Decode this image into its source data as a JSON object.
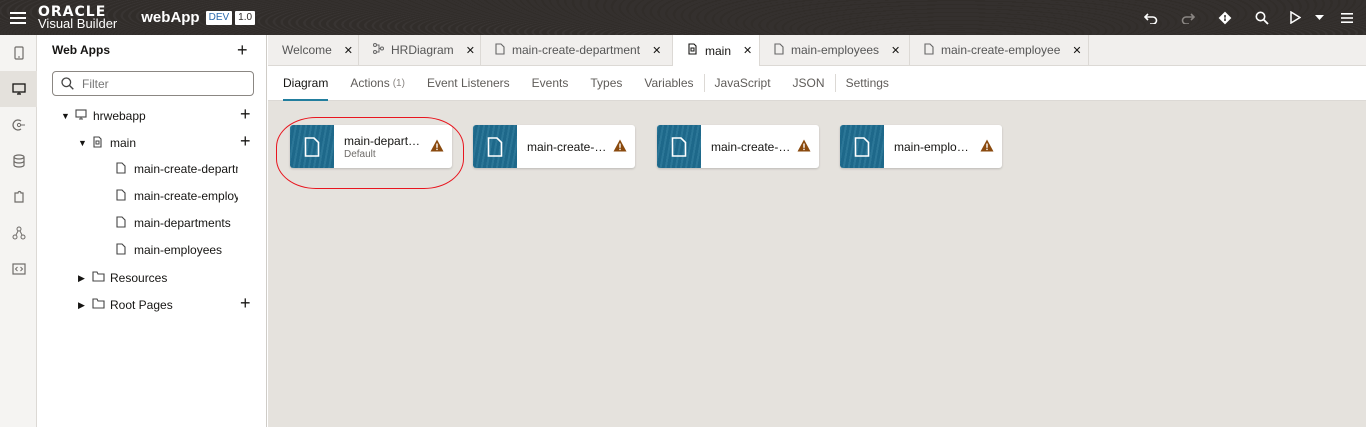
{
  "header": {
    "brand_top": "ORACLE",
    "brand_bottom": "Visual Builder",
    "app_name": "webApp",
    "env_badge": "DEV",
    "version_badge": "1.0",
    "icons": [
      "undo-icon",
      "redo-icon",
      "git-icon",
      "search-icon",
      "play-icon",
      "menu-icon"
    ]
  },
  "rail": {
    "items": [
      "mobile-apps-icon",
      "web-apps-icon",
      "services-icon",
      "business-objects-icon",
      "components-icon",
      "processes-icon",
      "source-icon"
    ]
  },
  "navigator": {
    "title": "Web Apps",
    "filter_placeholder": "Filter",
    "tree": {
      "app": "hrwebapp",
      "flow": "main",
      "pages": [
        "main-create-department",
        "main-create-employee",
        "main-departments",
        "main-employees"
      ],
      "resources": "Resources",
      "root_pages": "Root Pages"
    }
  },
  "tabs": [
    {
      "label": "Welcome",
      "icon": ""
    },
    {
      "label": "HRDiagram",
      "icon": "diagram-icon"
    },
    {
      "label": "main-create-department",
      "icon": "page-icon"
    },
    {
      "label": "main",
      "icon": "flow-icon",
      "active": true
    },
    {
      "label": "main-employees",
      "icon": "page-icon"
    },
    {
      "label": "main-create-employee",
      "icon": "page-icon"
    }
  ],
  "subtabs": {
    "diagram": "Diagram",
    "actions": "Actions",
    "actions_count": "(1)",
    "event_listeners": "Event Listeners",
    "events": "Events",
    "types": "Types",
    "variables": "Variables",
    "javascript": "JavaScript",
    "json": "JSON",
    "settings": "Settings"
  },
  "cards": [
    {
      "name": "main-departme...",
      "sub": "Default"
    },
    {
      "name": "main-create-de..."
    },
    {
      "name": "main-create-em..."
    },
    {
      "name": "main-employees"
    }
  ],
  "colors": {
    "header_bg": "#312d2a",
    "card_icon_bg": "#1f6e91",
    "warning": "#8a4a0e",
    "highlight": "#e8161f",
    "canvas_bg": "#e5e2dd"
  }
}
